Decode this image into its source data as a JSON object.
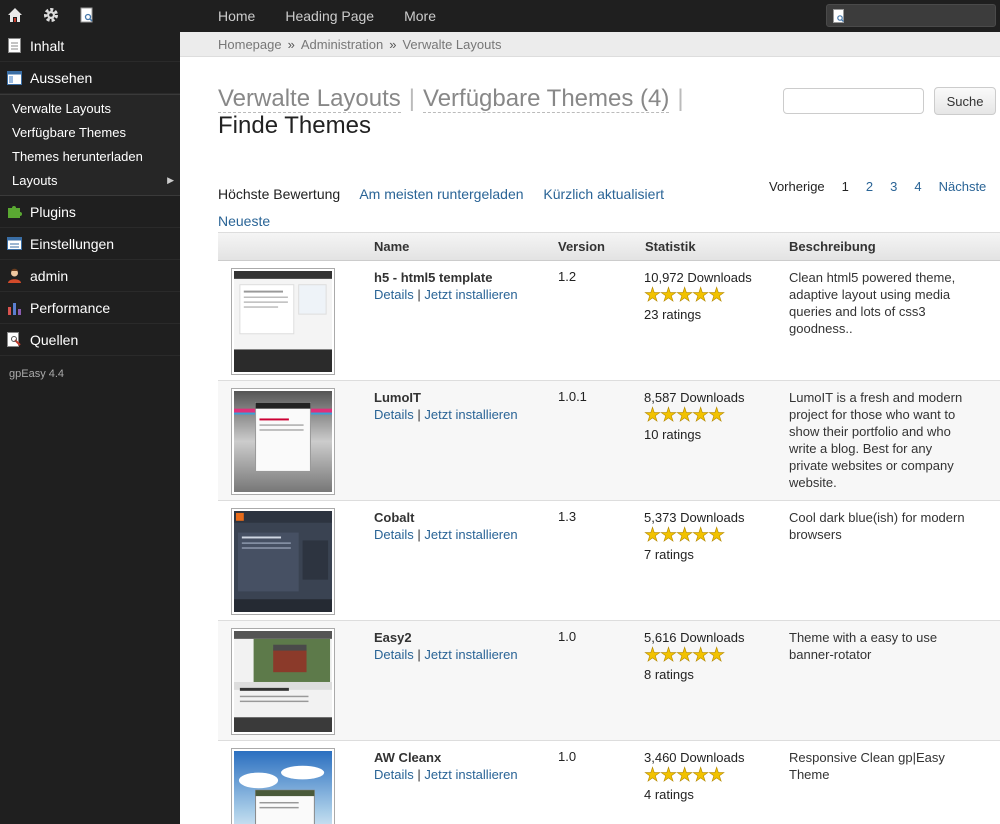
{
  "sidebar": {
    "top_icons": [
      "home-icon",
      "gear-icon",
      "page-search-icon"
    ],
    "items_top": [
      {
        "label": "Inhalt",
        "icon": "page-icon"
      },
      {
        "label": "Aussehen",
        "icon": "layout-icon"
      }
    ],
    "submenu": [
      "Verwalte Layouts",
      "Verfügbare Themes",
      "Themes herunterladen",
      "Layouts"
    ],
    "items_bottom": [
      {
        "label": "Plugins",
        "icon": "puzzle-icon"
      },
      {
        "label": "Einstellungen",
        "icon": "settings-window-icon"
      },
      {
        "label": "admin",
        "icon": "user-icon"
      },
      {
        "label": "Performance",
        "icon": "bar-chart-icon"
      },
      {
        "label": "Quellen",
        "icon": "resources-icon"
      }
    ],
    "version": "gpEasy 4.4"
  },
  "topnav": [
    "Home",
    "Heading Page",
    "More"
  ],
  "breadcrumb": [
    "Homepage",
    "Administration",
    "Verwalte Layouts"
  ],
  "breadcrumb_sep": "»",
  "heading": {
    "link1": "Verwalte Layouts",
    "link2": "Verfügbare Themes (4)",
    "separator": "|",
    "current": "Finde Themes"
  },
  "search": {
    "button": "Suche",
    "placeholder": ""
  },
  "tabs": [
    "Höchste Bewertung",
    "Am meisten runtergeladen",
    "Kürzlich aktualisiert",
    "Neueste"
  ],
  "pager": [
    "Vorherige",
    "1",
    "2",
    "3",
    "4",
    "Nächste"
  ],
  "table": {
    "headers": [
      "Name",
      "Version",
      "Statistik",
      "Beschreibung"
    ],
    "links": {
      "details": "Details",
      "sep": "|",
      "install": "Jetzt installieren"
    },
    "rows": [
      {
        "name": "h5 - html5 template",
        "version": "1.2",
        "downloads": "10,972 Downloads",
        "stars": 5,
        "ratings": "23 ratings",
        "description": "Clean html5 powered theme, adaptive layout using media queries and lots of css3 goodness.."
      },
      {
        "name": "LumoIT",
        "version": "1.0.1",
        "downloads": "8,587 Downloads",
        "stars": 5,
        "ratings": "10 ratings",
        "description": "LumoIT is a fresh and modern project for those who want to show their portfolio and who write a blog. Best for any private websites or company website."
      },
      {
        "name": "Cobalt",
        "version": "1.3",
        "downloads": "5,373 Downloads",
        "stars": 5,
        "ratings": "7 ratings",
        "description": "Cool dark blue(ish) for modern browsers"
      },
      {
        "name": "Easy2",
        "version": "1.0",
        "downloads": "5,616 Downloads",
        "stars": 5,
        "ratings": "8 ratings",
        "description": "Theme with a easy to use banner-rotator"
      },
      {
        "name": "AW Cleanx",
        "version": "1.0",
        "downloads": "3,460 Downloads",
        "stars": 5,
        "ratings": "4 ratings",
        "description": "Responsive Clean gp|Easy Theme"
      }
    ]
  }
}
